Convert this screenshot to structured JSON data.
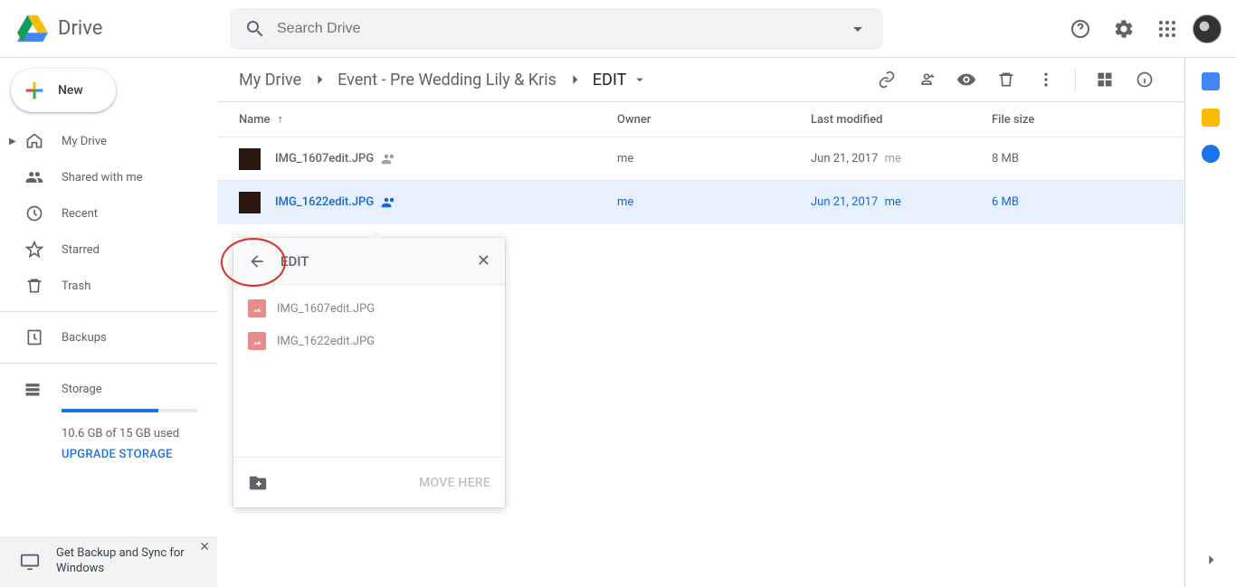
{
  "app_name": "Drive",
  "search": {
    "placeholder": "Search Drive"
  },
  "sidebar": {
    "new_label": "New",
    "items": [
      {
        "label": "My Drive"
      },
      {
        "label": "Shared with me"
      },
      {
        "label": "Recent"
      },
      {
        "label": "Starred"
      },
      {
        "label": "Trash"
      }
    ],
    "backups_label": "Backups",
    "storage_label": "Storage",
    "storage_used_text": "10.6 GB of 15 GB used",
    "storage_percent": 71,
    "upgrade_label": "UPGRADE STORAGE"
  },
  "backup_sync_banner": "Get Backup and Sync for Windows",
  "breadcrumb": {
    "items": [
      "My Drive",
      "Event - Pre Wedding Lily & Kris",
      "EDIT"
    ]
  },
  "columns": {
    "name": "Name",
    "owner": "Owner",
    "modified": "Last modified",
    "size": "File size"
  },
  "files": [
    {
      "name": "IMG_1607edit.JPG",
      "owner": "me",
      "modified": "Jun 21, 2017",
      "modified_by": "me",
      "size": "8 MB",
      "shared": true,
      "selected": false
    },
    {
      "name": "IMG_1622edit.JPG",
      "owner": "me",
      "modified": "Jun 21, 2017",
      "modified_by": "me",
      "size": "6 MB",
      "shared": true,
      "selected": true
    }
  ],
  "move_popup": {
    "title": "EDIT",
    "items": [
      {
        "name": "IMG_1607edit.JPG"
      },
      {
        "name": "IMG_1622edit.JPG"
      }
    ],
    "action_label": "MOVE HERE"
  }
}
